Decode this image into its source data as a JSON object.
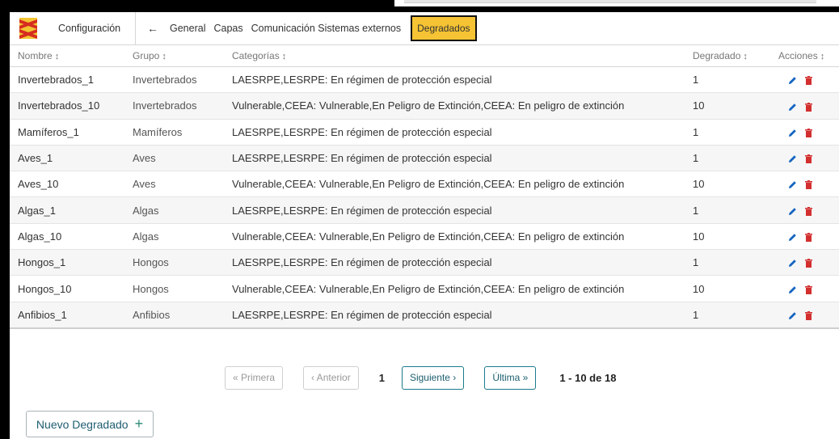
{
  "nav": {
    "config": "Configuración",
    "back": "←",
    "items": [
      "General",
      "Capas",
      "Comunicación Sistemas externos"
    ],
    "active": "Degradados"
  },
  "table": {
    "headers": [
      "Nombre",
      "Grupo",
      "Categorías",
      "Degradado",
      "Acciones"
    ],
    "sort_icon": "↕",
    "rows": [
      {
        "nombre": "Invertebrados_1",
        "grupo": "Invertebrados",
        "categorias": "LAESRPE,LESRPE: En régimen de protección especial",
        "degradado": "1"
      },
      {
        "nombre": "Invertebrados_10",
        "grupo": "Invertebrados",
        "categorias": "Vulnerable,CEEA: Vulnerable,En Peligro de Extinción,CEEA: En peligro de extinción",
        "degradado": "10"
      },
      {
        "nombre": "Mamíferos_1",
        "grupo": "Mamíferos",
        "categorias": "LAESRPE,LESRPE: En régimen de protección especial",
        "degradado": "1"
      },
      {
        "nombre": "Aves_1",
        "grupo": "Aves",
        "categorias": "LAESRPE,LESRPE: En régimen de protección especial",
        "degradado": "1"
      },
      {
        "nombre": "Aves_10",
        "grupo": "Aves",
        "categorias": "Vulnerable,CEEA: Vulnerable,En Peligro de Extinción,CEEA: En peligro de extinción",
        "degradado": "10"
      },
      {
        "nombre": "Algas_1",
        "grupo": "Algas",
        "categorias": "LAESRPE,LESRPE: En régimen de protección especial",
        "degradado": "1"
      },
      {
        "nombre": "Algas_10",
        "grupo": "Algas",
        "categorias": "Vulnerable,CEEA: Vulnerable,En Peligro de Extinción,CEEA: En peligro de extinción",
        "degradado": "10"
      },
      {
        "nombre": "Hongos_1",
        "grupo": "Hongos",
        "categorias": "LAESRPE,LESRPE: En régimen de protección especial",
        "degradado": "1"
      },
      {
        "nombre": "Hongos_10",
        "grupo": "Hongos",
        "categorias": "Vulnerable,CEEA: Vulnerable,En Peligro de Extinción,CEEA: En peligro de extinción",
        "degradado": "10"
      },
      {
        "nombre": "Anfibios_1",
        "grupo": "Anfibios",
        "categorias": "LAESRPE,LESRPE: En régimen de protección especial",
        "degradado": "1"
      }
    ]
  },
  "pagination": {
    "first": "« Primera",
    "prev": "‹ Anterior",
    "current": "1",
    "next": "Siguiente ›",
    "last": "Última »",
    "range": "1 - 10 de 18"
  },
  "new_button": {
    "label": "Nuevo Degradado",
    "icon": "+"
  },
  "colors": {
    "accent": "#f5c333",
    "edit": "#1565c0",
    "delete": "#d32f2f",
    "primary": "#1e5d70"
  }
}
